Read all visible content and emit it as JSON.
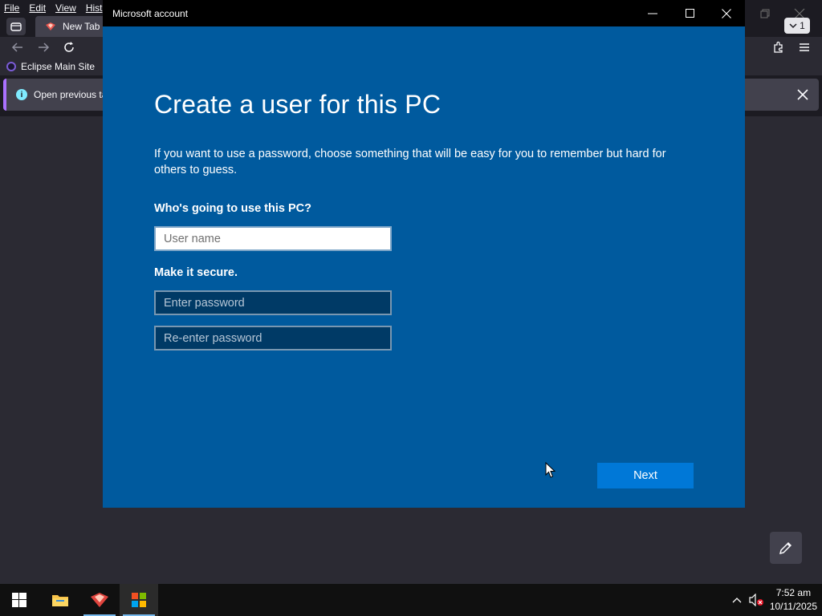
{
  "browser": {
    "menu": [
      "File",
      "Edit",
      "View",
      "Hist"
    ],
    "tab_title": "New Tab",
    "bookmark": "Eclipse Main Site",
    "infobar_text": "Open previous ta",
    "download_badge": "1"
  },
  "dialog": {
    "window_title": "Microsoft account",
    "heading": "Create a user for this PC",
    "intro": "If you want to use a password, choose something that will be easy for you to remember but hard for others to guess.",
    "who_label": "Who's going to use this PC?",
    "username_placeholder": "User name",
    "secure_label": "Make it secure.",
    "password_placeholder": "Enter password",
    "reenter_placeholder": "Re-enter password",
    "next_label": "Next"
  },
  "taskbar": {
    "time": "7:52 am",
    "date": "10/11/2025"
  },
  "colors": {
    "dialog_bg": "#005a9e",
    "accent": "#0078d7",
    "titlebar": "#000000",
    "browser_bg": "#2b2a33"
  },
  "icons": [
    "tab-list-icon",
    "back-arrow-icon",
    "forward-arrow-icon",
    "reload-icon",
    "extensions-icon",
    "hamburger-menu-icon",
    "info-icon",
    "close-icon",
    "minimize-icon",
    "maximize-icon",
    "pencil-icon",
    "windows-start-icon",
    "file-explorer-icon",
    "app-icon",
    "microsoft-store-icon",
    "chevron-up-icon",
    "volume-muted-icon",
    "restore-icon"
  ]
}
